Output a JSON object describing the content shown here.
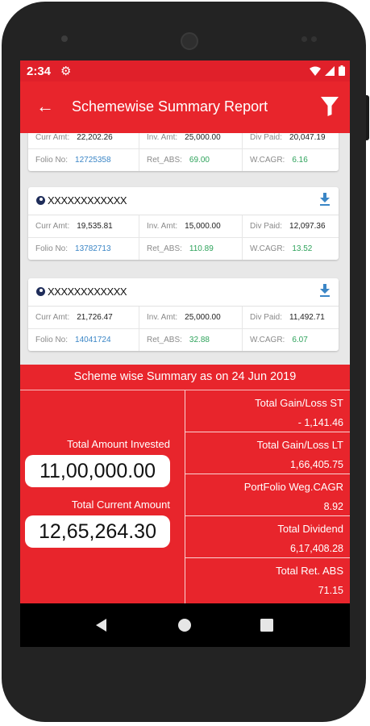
{
  "status_bar": {
    "time": "2:34"
  },
  "app_bar": {
    "title": "Schemewise Summary Report"
  },
  "cards": [
    {
      "name": "",
      "curr_amt_label": "Curr Amt:",
      "curr_amt": "22,202.26",
      "inv_amt_label": "Inv. Amt:",
      "inv_amt": "25,000.00",
      "div_paid_label": "Div Paid:",
      "div_paid": "20,047.19",
      "folio_label": "Folio No:",
      "folio": "12725358",
      "ret_abs_label": "Ret_ABS:",
      "ret_abs": "69.00",
      "wcagr_label": "W.CAGR:",
      "wcagr": "6.16"
    },
    {
      "name": "XXXXXXXXXXXX",
      "curr_amt_label": "Curr Amt:",
      "curr_amt": "19,535.81",
      "inv_amt_label": "Inv. Amt:",
      "inv_amt": "15,000.00",
      "div_paid_label": "Div Paid:",
      "div_paid": "12,097.36",
      "folio_label": "Folio No:",
      "folio": "13782713",
      "ret_abs_label": "Ret_ABS:",
      "ret_abs": "110.89",
      "wcagr_label": "W.CAGR:",
      "wcagr": "13.52"
    },
    {
      "name": "XXXXXXXXXXXX",
      "curr_amt_label": "Curr Amt:",
      "curr_amt": "21,726.47",
      "inv_amt_label": "Inv. Amt:",
      "inv_amt": "25,000.00",
      "div_paid_label": "Div Paid:",
      "div_paid": "11,492.71",
      "folio_label": "Folio No:",
      "folio": "14041724",
      "ret_abs_label": "Ret_ABS:",
      "ret_abs": "32.88",
      "wcagr_label": "W.CAGR:",
      "wcagr": "6.07"
    }
  ],
  "summary": {
    "title": "Scheme wise Summary as on 24 Jun 2019",
    "total_invested_label": "Total Amount Invested",
    "total_invested": "11,00,000.00",
    "total_current_label": "Total Current Amount",
    "total_current": "12,65,264.30",
    "stats": [
      {
        "label": "Total Gain/Loss ST",
        "value": "- 1,141.46"
      },
      {
        "label": "Total Gain/Loss LT",
        "value": "1,66,405.75"
      },
      {
        "label": "PortFolio Weg.CAGR",
        "value": "8.92"
      },
      {
        "label": "Total Dividend",
        "value": "6,17,408.28"
      },
      {
        "label": "Total Ret. ABS",
        "value": "71.15"
      }
    ]
  },
  "colors": {
    "primary": "#e8252c",
    "link": "#3b86c6",
    "positive": "#2ea35b"
  },
  "icons": [
    "gear-icon",
    "wifi-icon",
    "signal-icon",
    "battery-icon",
    "back-arrow-icon",
    "filter-icon",
    "user-icon",
    "download-icon",
    "nav-back-icon",
    "nav-home-icon",
    "nav-recents-icon"
  ]
}
